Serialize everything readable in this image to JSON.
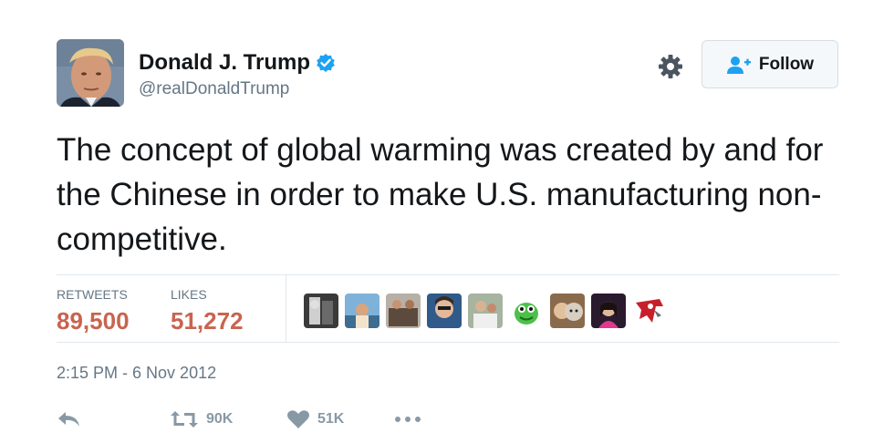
{
  "user": {
    "display_name": "Donald J. Trump",
    "handle": "@realDonaldTrump",
    "verified_icon": "verified-badge-icon",
    "avatar": "profile-photo"
  },
  "header": {
    "settings_icon": "gear-icon",
    "follow_label": "Follow",
    "follow_icon": "follow-user-icon"
  },
  "tweet": {
    "text": "The concept of global warming was created by and for the Chinese in order to make U.S. manufacturing non-competitive."
  },
  "stats": {
    "retweets_label": "RETWEETS",
    "retweets_value": "89,500",
    "likes_label": "LIKES",
    "likes_value": "51,272"
  },
  "likers": [
    {
      "name": "liker-avatar-1"
    },
    {
      "name": "liker-avatar-2"
    },
    {
      "name": "liker-avatar-3"
    },
    {
      "name": "liker-avatar-4"
    },
    {
      "name": "liker-avatar-5"
    },
    {
      "name": "liker-avatar-6"
    },
    {
      "name": "liker-avatar-7"
    },
    {
      "name": "liker-avatar-8"
    },
    {
      "name": "liker-avatar-9"
    }
  ],
  "timestamp": "2:15 PM - 6 Nov 2012",
  "actions": {
    "reply_icon": "reply-icon",
    "retweet_icon": "retweet-icon",
    "retweet_count": "90K",
    "like_icon": "heart-icon",
    "like_count": "51K",
    "more_icon": "more-dots-icon"
  },
  "colors": {
    "stat_value": "#c8644f",
    "muted_text": "#657786",
    "verified_blue": "#1da1f2",
    "divider": "#e1e8ed"
  }
}
